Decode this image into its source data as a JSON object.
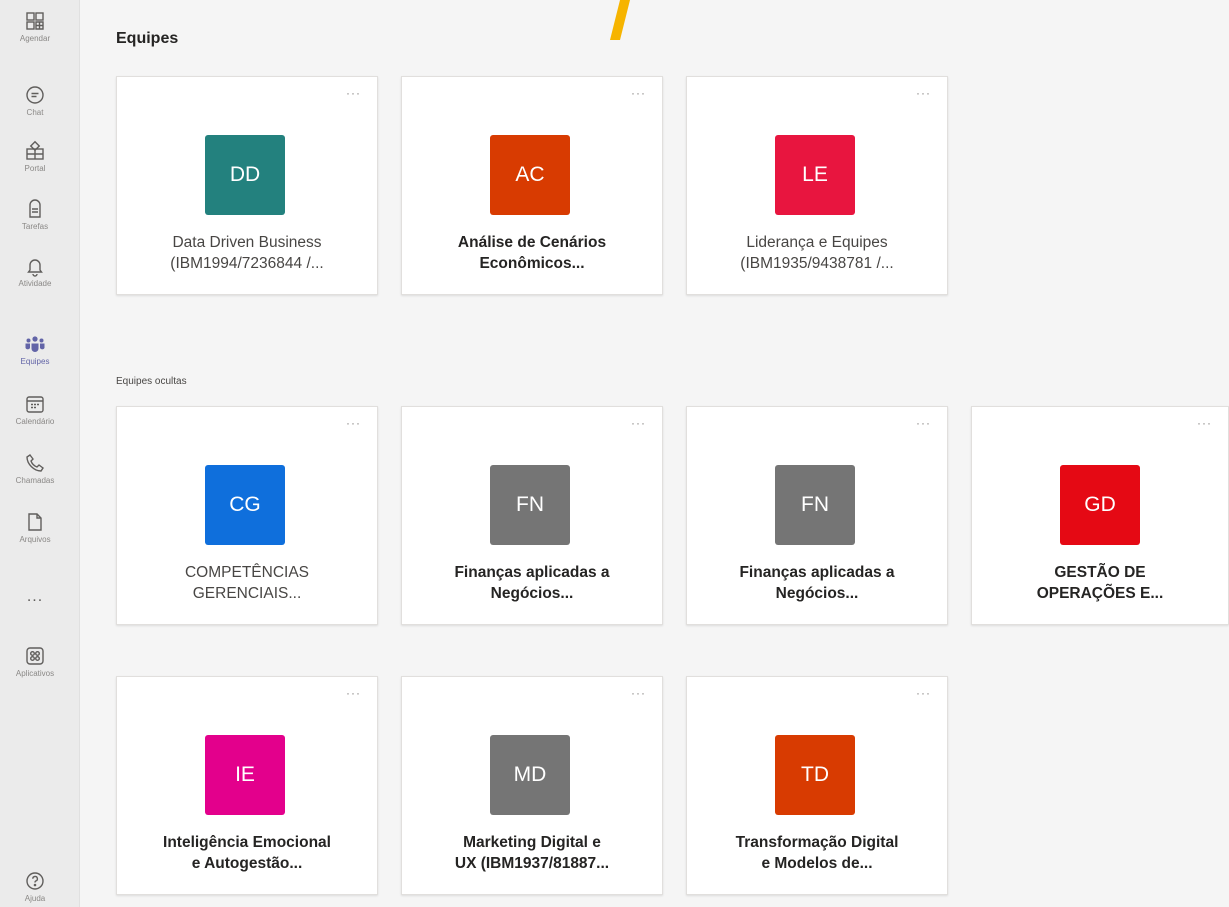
{
  "rail": {
    "items": [
      {
        "label": "Agendar",
        "icon": "calendar-grid-icon"
      },
      {
        "label": "Chat",
        "icon": "chat-icon"
      },
      {
        "label": "Portal",
        "icon": "portal-icon"
      },
      {
        "label": "Tarefas",
        "icon": "tasks-icon"
      },
      {
        "label": "Atividade",
        "icon": "bell-icon"
      },
      {
        "label": "Equipes",
        "icon": "teams-icon"
      },
      {
        "label": "Calendário",
        "icon": "calendar-icon"
      },
      {
        "label": "Chamadas",
        "icon": "phone-icon"
      },
      {
        "label": "Arquivos",
        "icon": "file-icon"
      },
      {
        "label": "...",
        "icon": "more-icon"
      },
      {
        "label": "Aplicativos",
        "icon": "apps-icon"
      }
    ],
    "help_label": "Ajuda",
    "active": "Equipes"
  },
  "page_title": "Equipes",
  "hidden_section_label": "Equipes ocultas",
  "colors": {
    "accent": "#6264a7",
    "teal": "#23817e",
    "orange": "#d83b01",
    "crimson": "#e8153f",
    "blue": "#0f6fdc",
    "gray": "#757575",
    "red": "#e50914",
    "magenta": "#e3008c"
  },
  "teams": [
    {
      "initials": "DD",
      "color": "#23817e",
      "line1": "Data Driven Business",
      "line2": "(IBM1994/7236844 /...",
      "bold": false,
      "more": "···"
    },
    {
      "initials": "AC",
      "color": "#d83b01",
      "line1": "Análise de Cenários",
      "line2": "Econômicos...",
      "bold": true,
      "more": "···"
    },
    {
      "initials": "LE",
      "color": "#e8153f",
      "line1": "Liderança e Equipes",
      "line2": "(IBM1935/9438781 /...",
      "bold": false,
      "more": "···"
    }
  ],
  "hidden_teams": [
    {
      "initials": "CG",
      "color": "#0f6fdc",
      "line1": "COMPETÊNCIAS",
      "line2": "GERENCIAIS...",
      "bold": false,
      "more": "···"
    },
    {
      "initials": "FN",
      "color": "#757575",
      "line1": "Finanças aplicadas a",
      "line2": "Negócios...",
      "bold": true,
      "more": "···"
    },
    {
      "initials": "FN",
      "color": "#757575",
      "line1": "Finanças aplicadas a",
      "line2": "Negócios...",
      "bold": true,
      "more": "···"
    },
    {
      "initials": "GD",
      "color": "#e50914",
      "line1": "GESTÃO DE",
      "line2": "OPERAÇÕES E...",
      "bold": true,
      "more": "···"
    },
    {
      "initials": "IE",
      "color": "#e3008c",
      "line1": "Inteligência Emocional",
      "line2": "e Autogestão...",
      "bold": true,
      "more": "···"
    },
    {
      "initials": "MD",
      "color": "#757575",
      "line1": "Marketing Digital e",
      "line2": "UX (IBM1937/81887...",
      "bold": true,
      "more": "···"
    },
    {
      "initials": "TD",
      "color": "#d83b01",
      "line1": "Transformação Digital",
      "line2": "e Modelos de...",
      "bold": true,
      "more": "···"
    }
  ]
}
